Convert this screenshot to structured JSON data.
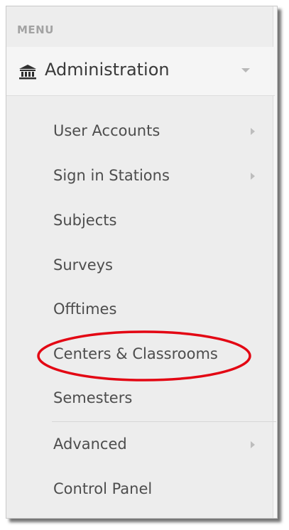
{
  "menu": {
    "header": "MENU",
    "admin": {
      "icon": "bank-building-icon",
      "label": "Administration"
    },
    "items": [
      {
        "label": "User Accounts",
        "has_submenu": true
      },
      {
        "label": "Sign in Stations",
        "has_submenu": true
      },
      {
        "label": "Subjects",
        "has_submenu": false
      },
      {
        "label": "Surveys",
        "has_submenu": false
      },
      {
        "label": "Offtimes",
        "has_submenu": false
      },
      {
        "label": "Centers & Classrooms",
        "has_submenu": false,
        "highlighted": true
      },
      {
        "label": "Semesters",
        "has_submenu": false
      },
      {
        "label": "Advanced",
        "has_submenu": true
      },
      {
        "label": "Control Panel",
        "has_submenu": false
      }
    ]
  },
  "colors": {
    "panel_background": "#ededed",
    "header_background": "#f5f5f5",
    "text": "#4d4d4d",
    "highlight_ellipse": "#e30613"
  }
}
